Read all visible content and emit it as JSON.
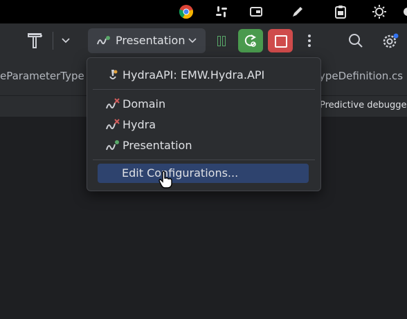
{
  "menubar": {
    "icons": [
      "chrome-icon",
      "slack-icon",
      "wallet-icon",
      "pen-icon",
      "clipboard-icon",
      "brightness-icon",
      "settings-icon"
    ]
  },
  "toolbar": {
    "run_config_label": "Presentation",
    "icons": [
      "hammer-icon",
      "chevron-down-icon",
      "pause-icon",
      "rerun-icon",
      "stop-icon",
      "more-icon",
      "search-icon",
      "gear-icon"
    ],
    "colors": {
      "rerun": "#4a9a4e",
      "stop": "#cf4b4b",
      "accent_green": "#59a869",
      "accent_red": "#d35d5d"
    }
  },
  "tabs": {
    "left_fragment": "eParameterType",
    "right_fragment": "ypeDefinition.cs"
  },
  "info": {
    "right_text": "Predictive debugge"
  },
  "popup": {
    "items": [
      {
        "label": "HydraAPI: EMW.Hydra.API",
        "icon": "web-api-config-icon",
        "status": "warning"
      },
      {
        "label": "Domain",
        "icon": "dotnet-config-icon",
        "status": "error"
      },
      {
        "label": "Hydra",
        "icon": "dotnet-config-icon",
        "status": "error"
      },
      {
        "label": "Presentation",
        "icon": "dotnet-config-icon",
        "status": "running"
      },
      {
        "label": "Edit Configurations...",
        "icon": "",
        "status": "selected"
      }
    ]
  }
}
